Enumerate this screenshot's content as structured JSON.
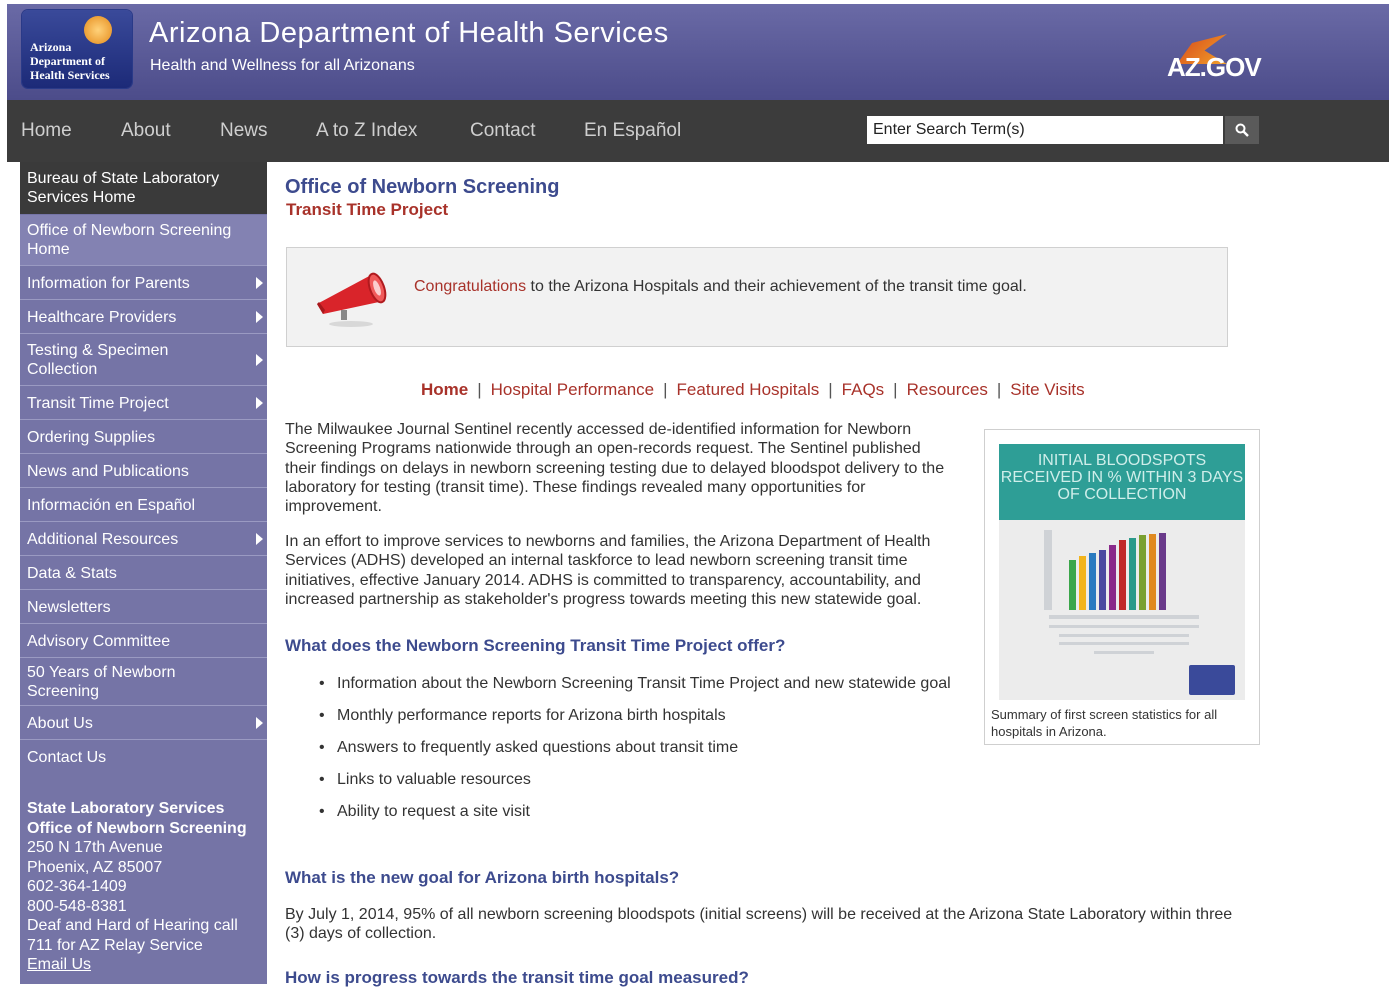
{
  "header": {
    "logo_lines": [
      "Arizona",
      "Department of",
      "Health Services"
    ],
    "title": "Arizona Department of Health Services",
    "tagline": "Health and Wellness for all Arizonans",
    "azgov": "AZ.GOV"
  },
  "nav": {
    "items": [
      "Home",
      "About",
      "News",
      "A to Z Index",
      "Contact",
      "En Español"
    ],
    "search_value": "Enter Search Term(s)"
  },
  "sidebar": {
    "home": "Bureau of State Laboratory Services Home",
    "items": [
      {
        "label": "Office of Newborn Screening Home",
        "arrow": false
      },
      {
        "label": "Information for Parents",
        "arrow": true
      },
      {
        "label": "Healthcare Providers",
        "arrow": true
      },
      {
        "label": "Testing & Specimen Collection",
        "arrow": true
      },
      {
        "label": "Transit Time Project",
        "arrow": true
      },
      {
        "label": "Ordering Supplies",
        "arrow": false
      },
      {
        "label": "News and Publications",
        "arrow": false
      },
      {
        "label": "Información en Español",
        "arrow": false
      },
      {
        "label": "Additional Resources",
        "arrow": true
      },
      {
        "label": "Data & Stats",
        "arrow": false
      },
      {
        "label": "Newsletters",
        "arrow": false
      },
      {
        "label": "Advisory Committee",
        "arrow": false
      },
      {
        "label": "50 Years of Newborn Screening",
        "arrow": false
      },
      {
        "label": "About Us",
        "arrow": true
      },
      {
        "label": "Contact Us",
        "arrow": false
      }
    ],
    "contact": {
      "org1": "State Laboratory Services",
      "org2": "Office of Newborn Screening",
      "address1": "250 N 17th Avenue",
      "address2": "Phoenix, AZ 85007",
      "phone1": "602-364-1409",
      "phone2": "800-548-8381",
      "relay1": "Deaf and Hard of Hearing call",
      "relay2": "711 for AZ Relay Service",
      "email": "Email Us"
    }
  },
  "main": {
    "title": "Office of Newborn Screening",
    "subtitle": "Transit Time Project",
    "announcement": {
      "highlight": "Congratulations",
      "rest": " to the Arizona Hospitals and their achievement of the transit time goal."
    },
    "subnav": [
      "Home",
      "Hospital Performance",
      "Featured Hospitals",
      "FAQs",
      "Resources",
      "Site Visits"
    ],
    "para1": "The Milwaukee Journal Sentinel recently accessed de-identified information for Newborn Screening Programs nationwide through an open-records request. The Sentinel published their findings on delays in newborn screening testing due to delayed bloodspot delivery to the laboratory for testing (transit time). These findings revealed many opportunities for improvement.",
    "para2": "In an effort to improve services to newborns and families, the Arizona Department of Health Services (ADHS) developed an internal taskforce to lead newborn screening transit time initiatives, effective January 2014. ADHS is committed to transparency, accountability, and increased partnership as stakeholder's progress towards meeting this new statewide goal.",
    "q1": "What does the Newborn Screening Transit Time Project offer?",
    "offer_items": [
      "Information about the Newborn Screening Transit Time Project and new statewide goal",
      "Monthly performance reports for Arizona birth hospitals",
      "Answers to frequently asked questions about transit time",
      "Links to valuable resources",
      "Ability to request a site visit"
    ],
    "q2": "What is the new goal for Arizona birth hospitals?",
    "para3": "By July 1, 2014, 95% of all newborn screening bloodspots (initial screens) will be received at the Arizona State Laboratory within three (3) days of collection.",
    "q3": "How is progress towards the transit time goal measured?",
    "infographic": {
      "heading": "INITIAL BLOODSPOTS RECEIVED IN % WITHIN 3 DAYS OF COLLECTION",
      "caption": "Summary of first screen statistics for all hospitals in Arizona."
    }
  }
}
